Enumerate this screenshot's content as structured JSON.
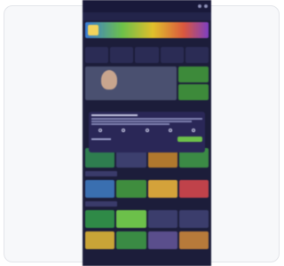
{
  "app": {
    "logo": ""
  },
  "nav": {
    "items": [
      "",
      "",
      "",
      "",
      "",
      ""
    ]
  },
  "colors": {
    "page_bg": "#1c1d3a",
    "accent": "#8ad14a",
    "modal_bg": "#2a2757"
  }
}
